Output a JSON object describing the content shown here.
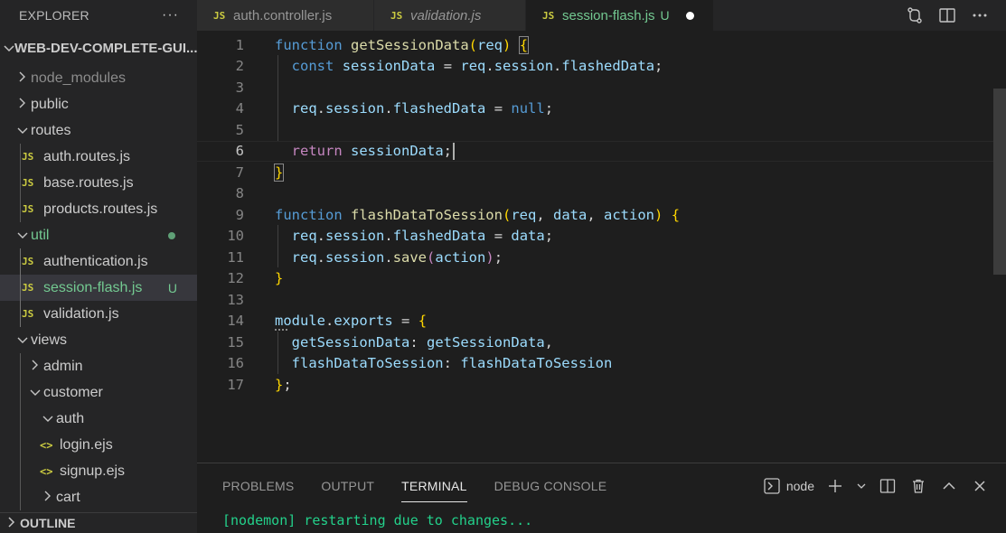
{
  "sidebar": {
    "header": "EXPLORER",
    "more": "···",
    "project": "WEB-DEV-COMPLETE-GUI...",
    "items": [
      {
        "label": "node_modules",
        "kind": "folder-closed",
        "depth": 1,
        "dim": true
      },
      {
        "label": "public",
        "kind": "folder-closed",
        "depth": 1
      },
      {
        "label": "routes",
        "kind": "folder-open",
        "depth": 1
      },
      {
        "label": "auth.routes.js",
        "kind": "js",
        "depth": 2
      },
      {
        "label": "base.routes.js",
        "kind": "js",
        "depth": 2
      },
      {
        "label": "products.routes.js",
        "kind": "js",
        "depth": 2
      },
      {
        "label": "util",
        "kind": "folder-open",
        "depth": 1,
        "dot": true
      },
      {
        "label": "authentication.js",
        "kind": "js",
        "depth": 2
      },
      {
        "label": "session-flash.js",
        "kind": "js",
        "depth": 2,
        "status": "U",
        "active": true
      },
      {
        "label": "validation.js",
        "kind": "js",
        "depth": 2
      },
      {
        "label": "views",
        "kind": "folder-open",
        "depth": 1
      },
      {
        "label": "admin",
        "kind": "folder-closed",
        "depth": 2
      },
      {
        "label": "customer",
        "kind": "folder-open",
        "depth": 2
      },
      {
        "label": "auth",
        "kind": "folder-open",
        "depth": 3
      },
      {
        "label": "login.ejs",
        "kind": "ejs",
        "depth": 4
      },
      {
        "label": "signup.ejs",
        "kind": "ejs",
        "depth": 4
      },
      {
        "label": "cart",
        "kind": "folder-closed",
        "depth": 3
      }
    ],
    "outline": "OUTLINE"
  },
  "tabs": [
    {
      "label": "auth.controller.js",
      "badge": "JS"
    },
    {
      "label": "validation.js",
      "badge": "JS",
      "italic": true
    },
    {
      "label": "session-flash.js",
      "badge": "JS",
      "status": "U",
      "active": true
    }
  ],
  "editor": {
    "current_line": 6,
    "lines": [
      "1",
      "2",
      "3",
      "4",
      "5",
      "6",
      "7",
      "8",
      "9",
      "10",
      "11",
      "12",
      "13",
      "14",
      "15",
      "16",
      "17"
    ]
  },
  "panel": {
    "tabs": [
      "PROBLEMS",
      "OUTPUT",
      "TERMINAL",
      "DEBUG CONSOLE"
    ],
    "active_tab": "TERMINAL",
    "terminal_name": "node",
    "terminal_output": "[nodemon] restarting due to changes..."
  },
  "colors": {
    "accent_untracked": "#73c991",
    "js_badge": "#cbcb41",
    "keyword": "#569cd6",
    "function": "#dcdcaa",
    "variable": "#9cdcfe"
  }
}
